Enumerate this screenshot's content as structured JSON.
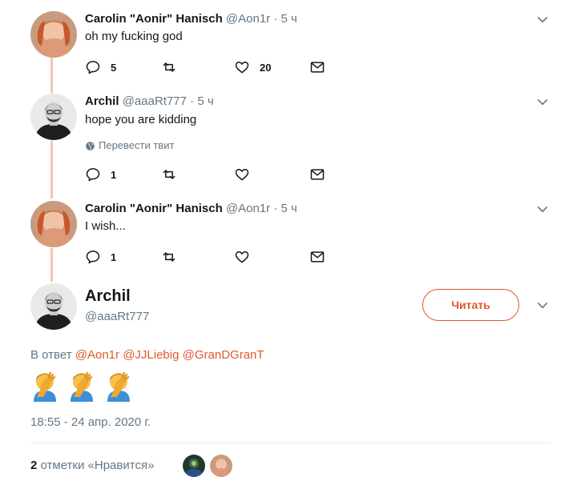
{
  "colors": {
    "accent": "#e0592a",
    "thread_line": "#f7c2b2",
    "secondary_text": "#657786"
  },
  "thread": [
    {
      "name": "Carolin \"Aonir\" Hanisch",
      "handle": "@Aon1r",
      "dot": "·",
      "time": "5 ч",
      "text": "oh my fucking god",
      "replies": "5",
      "retweets": "",
      "likes": "20",
      "translate": ""
    },
    {
      "name": "Archil",
      "handle": "@aaaRt777",
      "dot": "·",
      "time": "5 ч",
      "text": "hope you are kidding",
      "replies": "1",
      "retweets": "",
      "likes": "",
      "translate": "Перевести твит"
    },
    {
      "name": "Carolin \"Aonir\" Hanisch",
      "handle": "@Aon1r",
      "dot": "·",
      "time": "5 ч",
      "text": "I wish...",
      "replies": "1",
      "retweets": "",
      "likes": "",
      "translate": ""
    }
  ],
  "main_tweet": {
    "name": "Archil",
    "handle": "@aaaRt777",
    "follow_label": "Читать",
    "reply_prefix": "В ответ",
    "mentions": [
      "@Aon1r",
      "@JJLiebig",
      "@GranDGranT"
    ],
    "emoji_name": "face-palm-emoji",
    "emoji_count": 3,
    "timestamp": "18:55 - 24 апр. 2020 г.",
    "likes_count": "2",
    "likes_label": "отметки «Нравится»"
  },
  "icons": {
    "reply": "reply-icon",
    "retweet": "retweet-icon",
    "like": "heart-icon",
    "dm": "envelope-icon",
    "more": "chevron-down-icon",
    "globe": "globe-icon"
  }
}
